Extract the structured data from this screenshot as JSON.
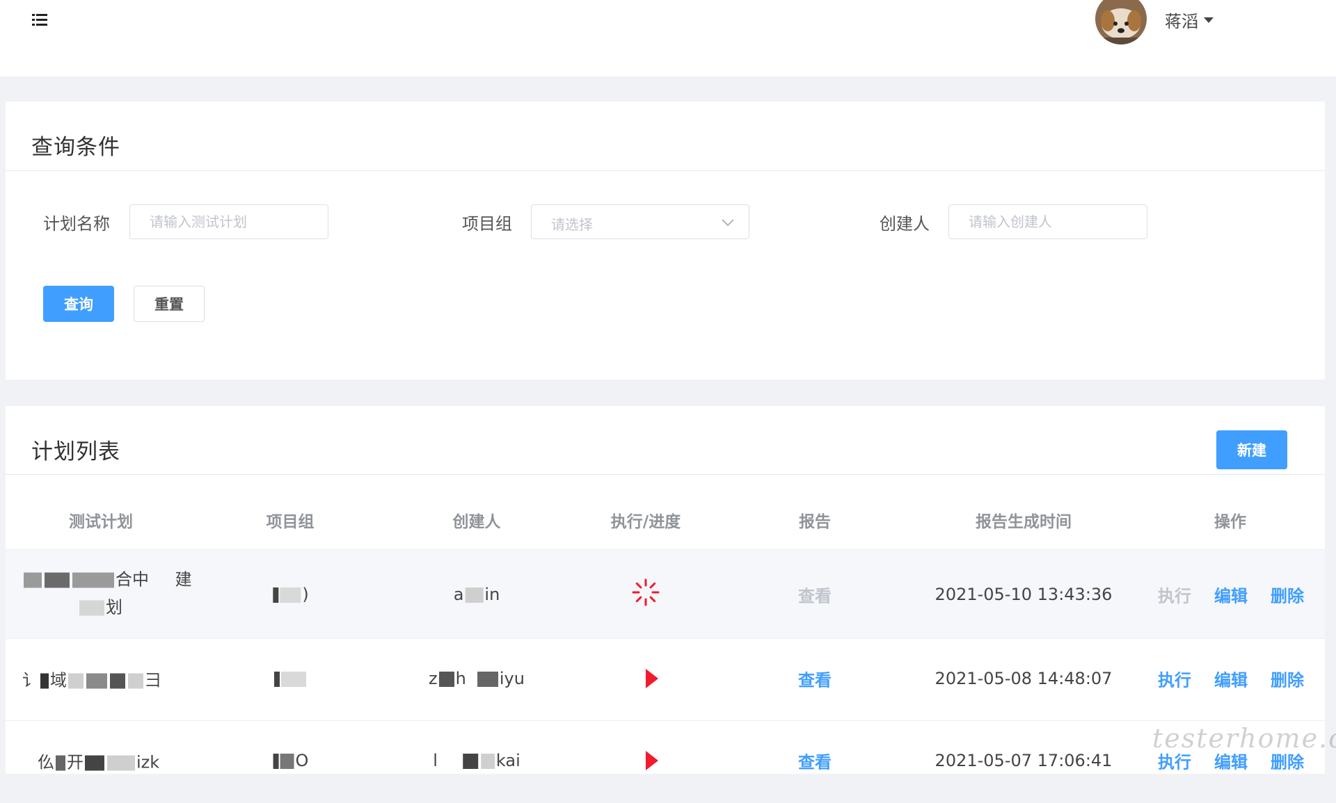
{
  "header": {
    "user_name": "蒋滔",
    "icons": {
      "menu": "hamburger-menu-icon",
      "user_caret": "caret-down-icon"
    }
  },
  "query_card": {
    "title": "查询条件",
    "fields": {
      "plan_name_label": "计划名称",
      "plan_name_placeholder": "请输入测试计划",
      "project_group_label": "项目组",
      "project_group_placeholder": "请选择",
      "creator_label": "创建人",
      "creator_placeholder": "请输入创建人"
    },
    "buttons": {
      "query": "查询",
      "reset": "重置"
    }
  },
  "list_card": {
    "title": "计划列表",
    "new_button": "新建",
    "columns": [
      "测试计划",
      "项目组",
      "创建人",
      "执行/进度",
      "报告",
      "报告生成时间",
      "操作"
    ],
    "rows": [
      {
        "plan_line1": "合中",
        "plan_line1b": "建",
        "plan_line2": "划",
        "group": ")",
        "creator_a": "a",
        "creator_b": "in",
        "status": "running",
        "report": "查看",
        "report_enabled": false,
        "time": "2021-05-10 13:43:36",
        "actions": {
          "run": "执行",
          "edit": "编辑",
          "delete": "删除"
        },
        "run_enabled": false
      },
      {
        "plan_a": "讠",
        "plan_b": "域",
        "plan_c": "彐",
        "group": "",
        "creator_a": "z",
        "creator_b": "h",
        "creator_c": "iyu",
        "status": "ready",
        "report": "查看",
        "report_enabled": true,
        "time": "2021-05-08 14:48:07",
        "actions": {
          "run": "执行",
          "edit": "编辑",
          "delete": "删除"
        },
        "run_enabled": true
      },
      {
        "plan_a": "仫",
        "plan_b": "开",
        "plan_c": "izk",
        "group": "O",
        "creator_a": "l",
        "creator_c": "kai",
        "status": "ready",
        "report": "查看",
        "report_enabled": true,
        "time": "2021-05-07 17:06:41",
        "actions": {
          "run": "执行",
          "edit": "编辑",
          "delete": "删除"
        },
        "run_enabled": true
      }
    ]
  },
  "watermark": "testerhome.com",
  "colors": {
    "primary": "#409eff",
    "play": "#f21b2d",
    "muted": "#c0c4cc",
    "page_bg": "#f0f2f5"
  }
}
